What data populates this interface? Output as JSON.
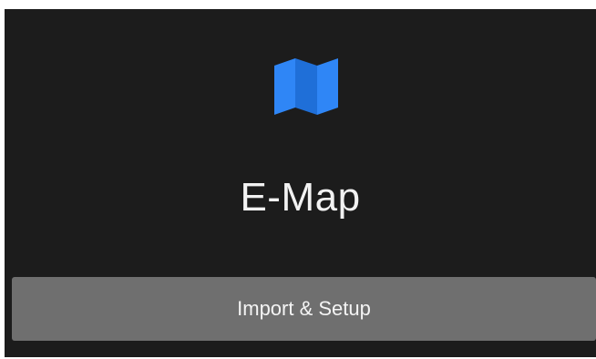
{
  "app": {
    "title": "E-Map",
    "icon": "map-icon",
    "accent_color": "#2f86f6"
  },
  "actions": {
    "primary_label": "Import & Setup"
  }
}
